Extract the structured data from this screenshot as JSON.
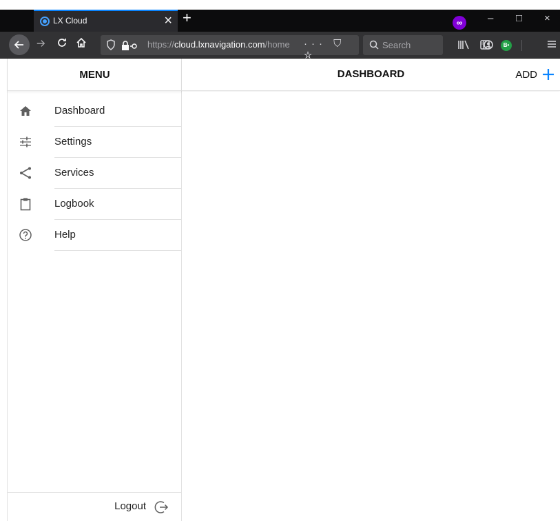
{
  "browser": {
    "tab_title": "LX Cloud",
    "tab_close": "×",
    "new_tab": "+",
    "url_scheme": "https://",
    "url_host": "cloud.lxnavigation.com",
    "url_path": "/home",
    "search_placeholder": "Search",
    "page_actions": "··· ⛉ ☆",
    "window_minimize": "–",
    "window_maximize": "□",
    "window_close": "×",
    "addon_badge": "B•"
  },
  "sidebar": {
    "title": "MENU",
    "items": [
      {
        "label": "Dashboard",
        "icon": "home-icon"
      },
      {
        "label": "Settings",
        "icon": "sliders-icon"
      },
      {
        "label": "Services",
        "icon": "share-icon"
      },
      {
        "label": "Logbook",
        "icon": "clipboard-icon"
      },
      {
        "label": "Help",
        "icon": "help-icon"
      }
    ],
    "logout_label": "Logout"
  },
  "main": {
    "title": "DASHBOARD",
    "add_label": "ADD"
  },
  "colors": {
    "accent": "#0a84ff",
    "icon_gray": "#5f5f5f",
    "divider": "#e2e2e2",
    "chrome_dark": "#0c0c0d",
    "private_badge": "#8000d7"
  }
}
